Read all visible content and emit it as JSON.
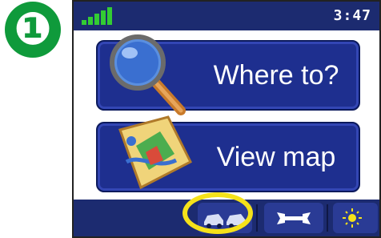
{
  "step": {
    "number": "❶"
  },
  "statusbar": {
    "time": "3:47",
    "signal_icon": "signal-bars-icon"
  },
  "menu": {
    "where_to": {
      "label": "Where to?",
      "icon": "magnifier-icon"
    },
    "view_map": {
      "label": "View map",
      "icon": "map-icon"
    }
  },
  "toolbar": {
    "vehicles_icon": "vehicles-icon",
    "settings_icon": "wrench-icon",
    "brightness_icon": "sun-icon",
    "highlight_color": "#f5e21a"
  }
}
